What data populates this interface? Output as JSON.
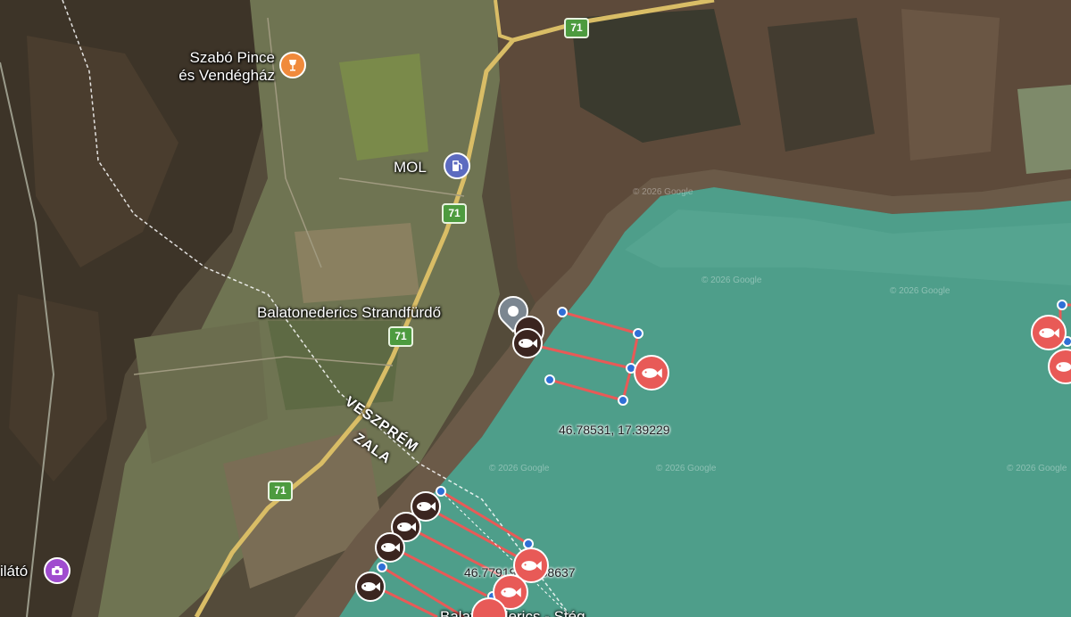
{
  "map": {
    "colors": {
      "lake": "#4e9e8a",
      "shore_reeds": "#6b5a48",
      "farmland": "#6f7452",
      "forest": "#3d3428",
      "road": "#e0c060",
      "boundary_line": "#ffffff",
      "fishing_area_line": "#e85a57",
      "vertex_dot": "#2f6fd6",
      "fish_marker_brown": "#3b2520",
      "fish_marker_red": "#e85a57",
      "route_shield": "#4d9b3f",
      "fuel_poi": "#5c6bc0",
      "wine_poi": "#f08a3c",
      "viewpoint_poi": "#a04ccf"
    },
    "labels": {
      "szabo_line1": "Szabó Pince",
      "szabo_line2": "és Vendégház",
      "mol": "MOL",
      "strandfurdo": "Balatonederics Strandfürdő",
      "kilato": "ilátó",
      "steg": "Balatonederics - Stég",
      "county_north": "VESZPRÉM",
      "county_south": "ZALA"
    },
    "route_number": "71",
    "coordinates": {
      "point1": "46.78531, 17.39229",
      "point2": "46.77919, 17.38637"
    },
    "watermark": "© 2026 Google",
    "icons": [
      "wine-glass-icon",
      "fuel-pump-icon",
      "location-pin-icon",
      "camera-icon",
      "fish-icon",
      "route-shield-icon"
    ]
  }
}
